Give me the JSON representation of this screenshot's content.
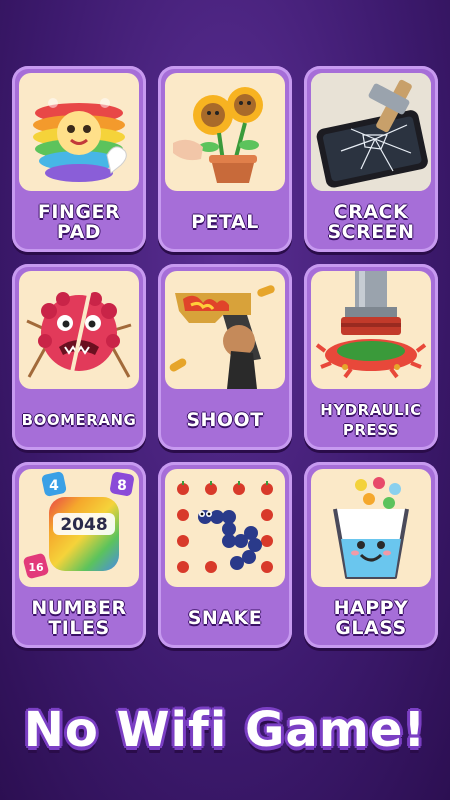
{
  "games": [
    {
      "label": "FINGER\nPAD",
      "icon": "pop-it-flower-icon"
    },
    {
      "label": "PETAL",
      "icon": "sunflower-pot-icon"
    },
    {
      "label": "CRACK\nSCREEN",
      "icon": "hammer-phone-icon"
    },
    {
      "label": "BOOMERANG",
      "icon": "red-monster-icon"
    },
    {
      "label": "SHOOT",
      "icon": "pistol-icon"
    },
    {
      "label": "HYDRAULIC\nPRESS",
      "icon": "hydraulic-press-icon"
    },
    {
      "label": "NUMBER\nTILES",
      "icon": "number-cube-icon",
      "tile_value": "2048",
      "small_tiles": [
        "4",
        "8",
        "16"
      ]
    },
    {
      "label": "SNAKE",
      "icon": "snake-apples-icon"
    },
    {
      "label": "HAPPY\nGLASS",
      "icon": "happy-glass-icon"
    }
  ],
  "footer_title": "No  Wifi Game!",
  "colors": {
    "background": "#3d1a6e",
    "card": "#a66ed8",
    "thumb": "#fbe9c8",
    "title_outline": "#7b3fc4"
  }
}
